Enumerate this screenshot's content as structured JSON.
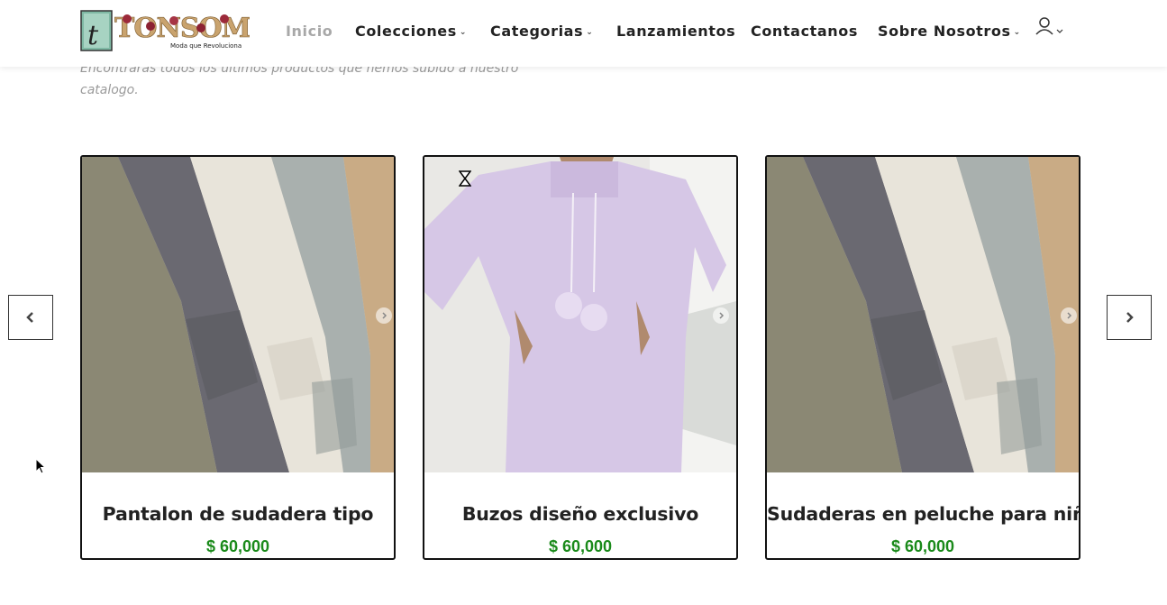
{
  "header": {
    "logo_text": "TONSOM",
    "logo_tagline": "Moda que Revoluciona",
    "nav": [
      {
        "label": "Inicio",
        "active": true,
        "dropdown": false
      },
      {
        "label": "Colecciones",
        "active": false,
        "dropdown": true
      },
      {
        "label": "Categorias",
        "active": false,
        "dropdown": true
      },
      {
        "label": "Lanzamientos",
        "active": false,
        "dropdown": false
      },
      {
        "label": "Contactanos",
        "active": false,
        "dropdown": false
      },
      {
        "label": "Sobre Nosotros",
        "active": false,
        "dropdown": true
      }
    ],
    "account_icon": "user-icon"
  },
  "intro": {
    "text": "Encontrarás todos los últimos productos que hemos subido a nuestro catalogo."
  },
  "carousel": {
    "prev_icon": "chevron-left-icon",
    "next_icon": "chevron-right-icon",
    "products": [
      {
        "title": "Pantalon de sudadera tipo",
        "price": "$ 60,000"
      },
      {
        "title": "Buzos diseño exclusivo",
        "price": "$ 60,000"
      },
      {
        "title": "Sudaderas en peluche para niños",
        "price": "$ 60,000"
      }
    ]
  },
  "colors": {
    "price": "#1a8a1a",
    "card_border": "#111111",
    "nav_active": "#a8a8a8"
  }
}
